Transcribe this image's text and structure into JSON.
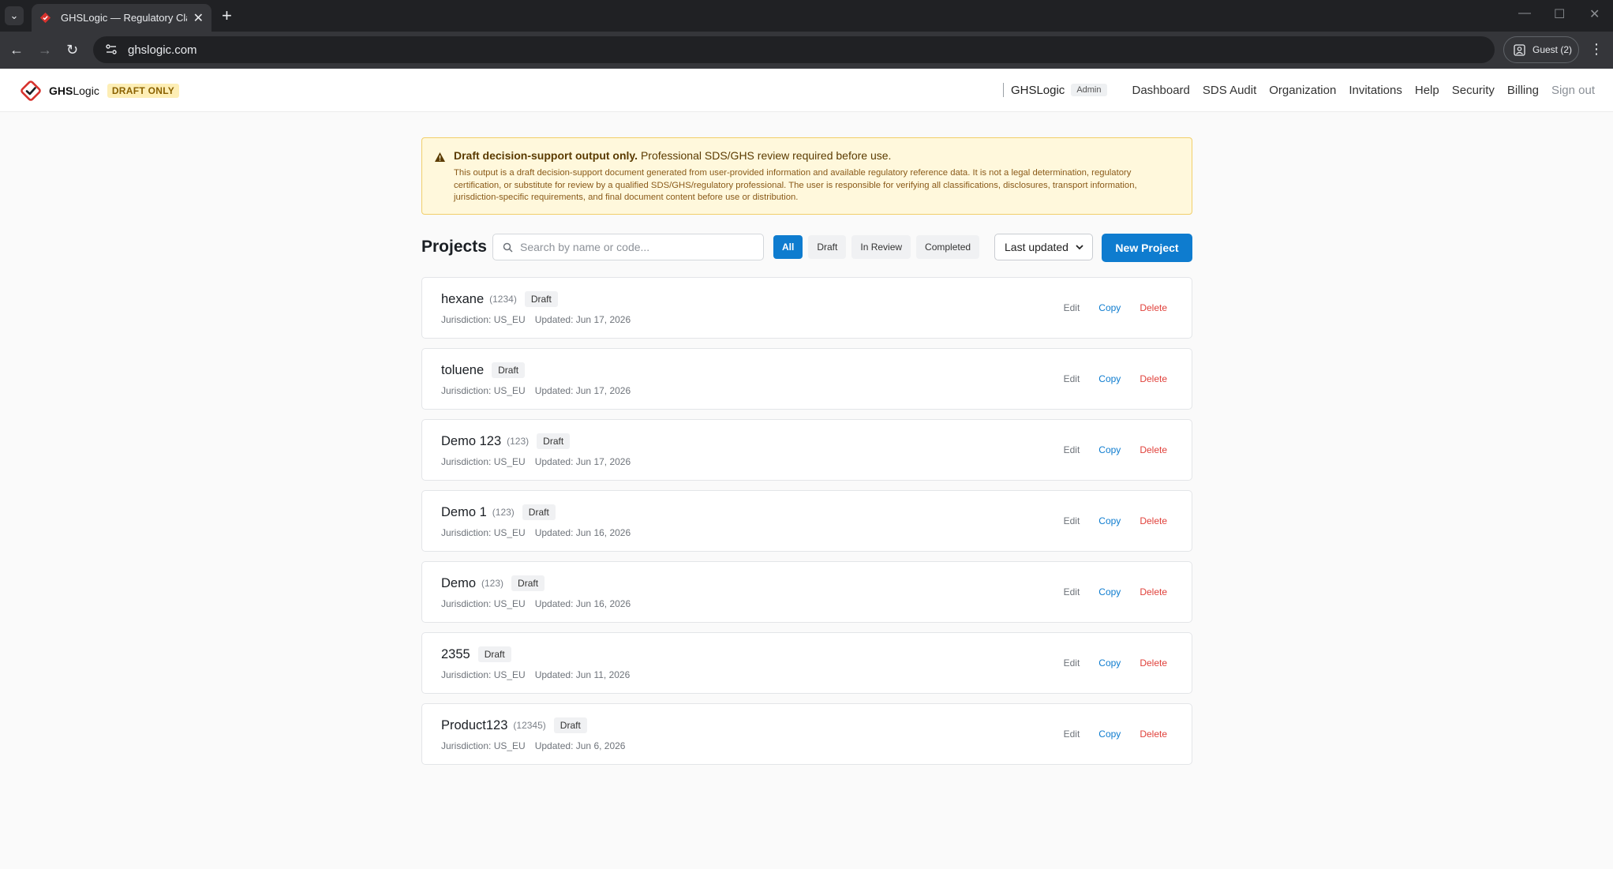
{
  "browser": {
    "tab_title": "GHSLogic — Regulatory Classification",
    "url": "ghslogic.com",
    "profile_label": "Guest (2)"
  },
  "header": {
    "brand_strong": "GHS",
    "brand_rest": "Logic",
    "draft_badge": "DRAFT ONLY",
    "org_name": "GHSLogic",
    "role": "Admin",
    "nav": [
      "Dashboard",
      "SDS Audit",
      "Organization",
      "Invitations",
      "Help",
      "Security",
      "Billing",
      "Sign out"
    ]
  },
  "disclaimer": {
    "headline_bold": "Draft decision-support output only.",
    "headline_rest": " Professional SDS/GHS review required before use.",
    "body": "This output is a draft decision-support document generated from user-provided information and available regulatory reference data. It is not a legal determination, regulatory certification, or substitute for review by a qualified SDS/GHS/regulatory professional. The user is responsible for verifying all classifications, disclosures, transport information, jurisdiction-specific requirements, and final document content before use or distribution."
  },
  "projects": {
    "title": "Projects",
    "search_placeholder": "Search by name or code...",
    "filters": [
      "All",
      "Draft",
      "In Review",
      "Completed"
    ],
    "sort_value": "Last updated",
    "new_button": "New Project",
    "action_labels": {
      "edit": "Edit",
      "copy": "Copy",
      "delete": "Delete"
    },
    "items": [
      {
        "name": "hexane",
        "code": "(1234)",
        "status": "Draft",
        "jurisdiction": "Jurisdiction: US_EU",
        "updated": "Updated: Jun 17, 2026"
      },
      {
        "name": "toluene",
        "code": "",
        "status": "Draft",
        "jurisdiction": "Jurisdiction: US_EU",
        "updated": "Updated: Jun 17, 2026"
      },
      {
        "name": "Demo 123",
        "code": "(123)",
        "status": "Draft",
        "jurisdiction": "Jurisdiction: US_EU",
        "updated": "Updated: Jun 17, 2026"
      },
      {
        "name": "Demo 1",
        "code": "(123)",
        "status": "Draft",
        "jurisdiction": "Jurisdiction: US_EU",
        "updated": "Updated: Jun 16, 2026"
      },
      {
        "name": "Demo",
        "code": "(123)",
        "status": "Draft",
        "jurisdiction": "Jurisdiction: US_EU",
        "updated": "Updated: Jun 16, 2026"
      },
      {
        "name": "2355",
        "code": "",
        "status": "Draft",
        "jurisdiction": "Jurisdiction: US_EU",
        "updated": "Updated: Jun 11, 2026"
      },
      {
        "name": "Product123",
        "code": "(12345)",
        "status": "Draft",
        "jurisdiction": "Jurisdiction: US_EU",
        "updated": "Updated: Jun 6, 2026"
      }
    ]
  },
  "colors": {
    "accent": "#0e7ccf",
    "danger": "#e0413b",
    "warning_bg": "#fff8dc",
    "logo_red": "#d7322d"
  },
  "icons": {
    "logo": "check-diamond-logo",
    "warning": "warning-triangle-icon",
    "search": "search-icon",
    "sort": "chevron-down-icon"
  }
}
